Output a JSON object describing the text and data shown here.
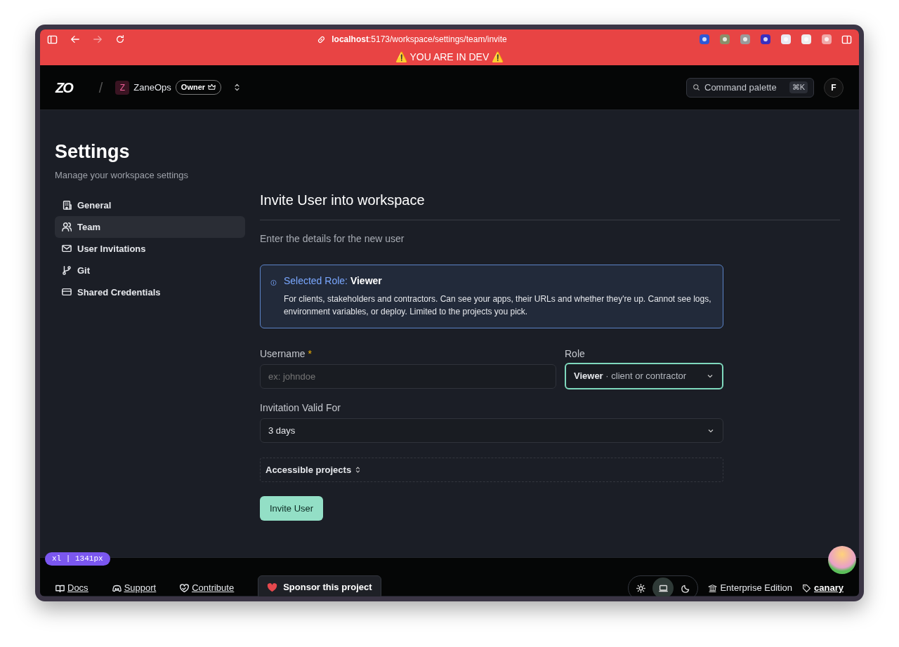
{
  "browser": {
    "url_host": "localhost",
    "url_path": ":5173/workspace/settings/team/invite"
  },
  "dev_banner": "⚠️ YOU ARE IN DEV ⚠️",
  "header": {
    "logo": "ZO",
    "separator": "/",
    "workspace": {
      "initial": "Z",
      "name": "ZaneOps",
      "role": "Owner"
    },
    "command_palette": {
      "label": "Command palette",
      "shortcut": "⌘K"
    },
    "avatar": "F"
  },
  "settings": {
    "title": "Settings",
    "subtitle": "Manage your workspace settings",
    "nav": [
      {
        "kind": "building",
        "label": "General",
        "selected": false
      },
      {
        "kind": "users",
        "label": "Team",
        "selected": true
      },
      {
        "kind": "mail",
        "label": "User Invitations",
        "selected": false
      },
      {
        "kind": "git",
        "label": "Git",
        "selected": false
      },
      {
        "kind": "card",
        "label": "Shared Credentials",
        "selected": false
      }
    ]
  },
  "form": {
    "title": "Invite User into workspace",
    "subtitle": "Enter the details for the new user",
    "alert": {
      "prefix": "Selected Role:",
      "role": "Viewer",
      "body": "For clients, stakeholders and contractors. Can see your apps, their URLs and whether they're up. Cannot see logs, environment variables, or deploy. Limited to the projects you pick."
    },
    "username": {
      "label": "Username",
      "required_mark": "*",
      "placeholder": "ex: johndoe"
    },
    "role": {
      "label": "Role",
      "value": "Viewer",
      "hint": "· client or contractor",
      "focused": true
    },
    "validity": {
      "label": "Invitation Valid For",
      "value": "3 days"
    },
    "projects": {
      "label": "Accessible projects"
    },
    "submit": "Invite User"
  },
  "breakpoint_badge": "xl | 1341px",
  "footer": {
    "links": [
      {
        "kind": "book",
        "label": "Docs"
      },
      {
        "kind": "discord",
        "label": "Support"
      },
      {
        "kind": "heart-outline",
        "label": "Contribute"
      }
    ],
    "sponsor": "Sponsor this project",
    "themes": [
      {
        "kind": "light",
        "selected": false
      },
      {
        "kind": "system",
        "selected": true
      },
      {
        "kind": "dark",
        "selected": false
      }
    ],
    "edition": "Enterprise Edition",
    "version": "canary"
  }
}
